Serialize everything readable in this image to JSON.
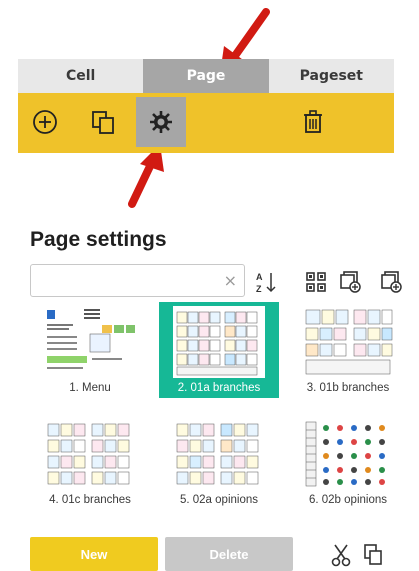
{
  "tabs": [
    {
      "label": "Cell",
      "active": false
    },
    {
      "label": "Page",
      "active": true
    },
    {
      "label": "Pageset",
      "active": false
    }
  ],
  "toolbar": {
    "color": "#efc22a",
    "tools": [
      {
        "icon": "add-circle-icon"
      },
      {
        "icon": "copy-icon"
      },
      {
        "icon": "gear-icon",
        "active": true
      },
      {
        "icon": "trash-icon"
      }
    ]
  },
  "panel": {
    "title": "Page settings",
    "search": {
      "value": "",
      "placeholder": "",
      "clear_icon": "×"
    },
    "actions": [
      "sort-az-icon",
      "grid-view-icon",
      "add-page-icon",
      "add-page-alt-icon"
    ],
    "pages": [
      {
        "label": "1. Menu",
        "selected": false
      },
      {
        "label": "2. 01a branches",
        "selected": true
      },
      {
        "label": "3. 01b branches",
        "selected": false
      },
      {
        "label": "4. 01c branches",
        "selected": false
      },
      {
        "label": "5. 02a opinions",
        "selected": false
      },
      {
        "label": "6. 02b opinions",
        "selected": false
      }
    ],
    "accent": "#16b896"
  },
  "bottom": {
    "new_label": "New",
    "delete_label": "Delete",
    "icons": [
      "cut-icon",
      "copy-icon"
    ]
  },
  "arrow_color": "#d11a12"
}
